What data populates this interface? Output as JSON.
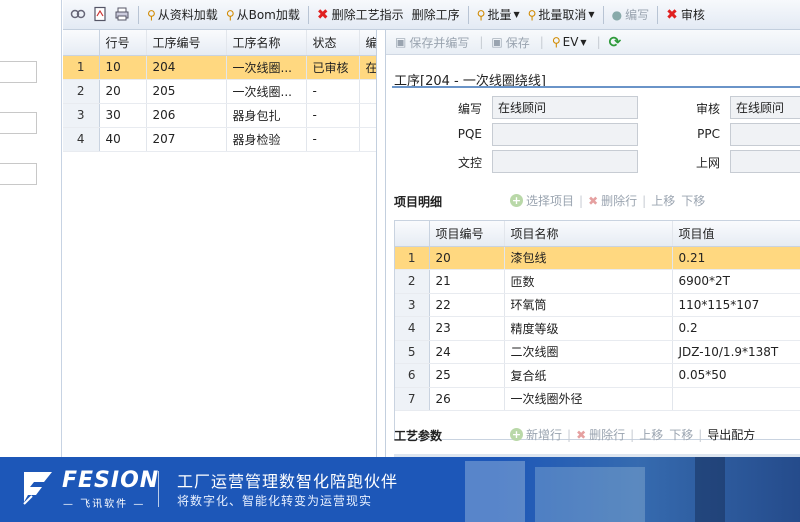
{
  "toolbar": {
    "icons": [
      "link-icon",
      "pdf-icon",
      "print-icon"
    ],
    "load_from_data": "从资料加载",
    "load_from_bom": "从Bom加载",
    "delete_instruction": "删除工艺指示",
    "delete_process": "删除工序",
    "batch": "批量",
    "batch_cancel": "批量取消",
    "edit": "编写",
    "review": "审核"
  },
  "process_grid": {
    "columns": [
      "行号",
      "工序编号",
      "工序名称",
      "状态",
      "编"
    ],
    "rows": [
      {
        "n": "1",
        "line": "10",
        "code": "204",
        "name": "一次线圈...",
        "status": "已审核",
        "extra": "在"
      },
      {
        "n": "2",
        "line": "20",
        "code": "205",
        "name": "一次线圈...",
        "status": "-",
        "extra": ""
      },
      {
        "n": "3",
        "line": "30",
        "code": "206",
        "name": "器身包扎",
        "status": "-",
        "extra": ""
      },
      {
        "n": "4",
        "line": "40",
        "code": "207",
        "name": "器身检验",
        "status": "-",
        "extra": ""
      }
    ]
  },
  "detail": {
    "toolbar": {
      "save_new": "保存并编写",
      "save": "保存",
      "ev": "EV"
    },
    "title": "工序[204 - 一次线圈绕线]",
    "fields": {
      "code_label": "编写",
      "code_value": "在线顾问",
      "review_label": "审核",
      "review_value": "在线顾问",
      "pqe_label": "PQE",
      "pqe_value": "",
      "ppc_label": "PPC",
      "ppc_value": "",
      "doc_label": "文控",
      "doc_value": "",
      "online_label": "上网",
      "online_value": ""
    },
    "items_section": {
      "title": "项目明细",
      "select": "选择项目",
      "delete_row": "删除行",
      "move_up": "上移",
      "move_down": "下移",
      "columns": [
        "项目编号",
        "项目名称",
        "项目值"
      ],
      "rows": [
        {
          "n": "1",
          "code": "20",
          "name": "漆包线",
          "value": "0.21"
        },
        {
          "n": "2",
          "code": "21",
          "name": "匝数",
          "value": "6900*2T"
        },
        {
          "n": "3",
          "code": "22",
          "name": "环氧筒",
          "value": "110*115*107"
        },
        {
          "n": "4",
          "code": "23",
          "name": "精度等级",
          "value": "0.2"
        },
        {
          "n": "5",
          "code": "24",
          "name": "二次线圈",
          "value": "JDZ-10/1.9*138T"
        },
        {
          "n": "6",
          "code": "25",
          "name": "复合纸",
          "value": "0.05*50"
        },
        {
          "n": "7",
          "code": "26",
          "name": "一次线圈外径",
          "value": ""
        }
      ]
    },
    "params_section": {
      "title": "工艺参数",
      "add_row": "新增行",
      "delete_row": "删除行",
      "move_up": "上移",
      "move_down": "下移",
      "export": "导出配方"
    }
  },
  "banner": {
    "logo": "FESION",
    "logo_sub": "— 飞讯软件 —",
    "title": "工厂运营管理数智化陪跑伙伴",
    "subtitle": "将数字化、智能化转变为运营现实"
  }
}
